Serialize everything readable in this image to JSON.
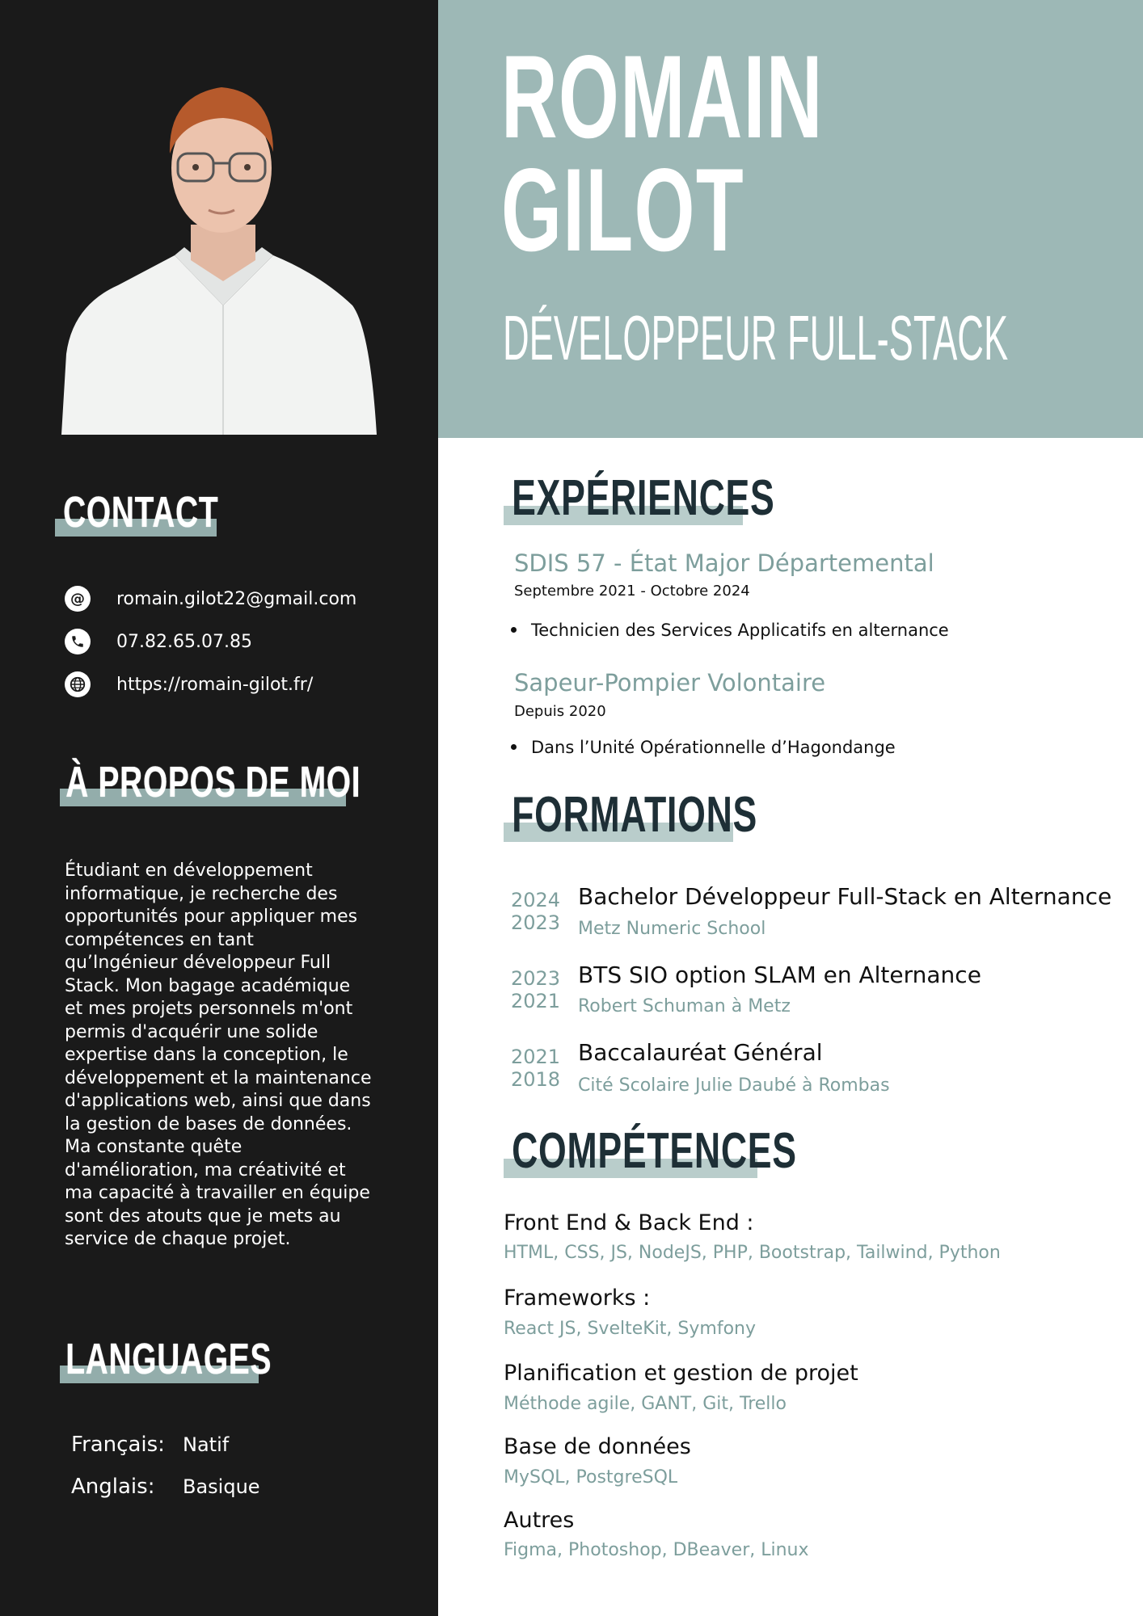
{
  "name": {
    "line1": "ROMAIN",
    "line2": "GILOT"
  },
  "job_title": "DÉVELOPPEUR FULL-STACK",
  "colors": {
    "sidebar": "#1a1a1a",
    "header": "#9db8b6",
    "accent": "#7d9e9c",
    "heading": "#1e2f36"
  },
  "sidebar": {
    "contact": {
      "heading": "CONTACT",
      "items": [
        {
          "icon": "at-icon",
          "value": "romain.gilot22@gmail.com"
        },
        {
          "icon": "phone-icon",
          "value": "07.82.65.07.85"
        },
        {
          "icon": "globe-icon",
          "value": "https://romain-gilot.fr/"
        }
      ]
    },
    "about": {
      "heading": "À PROPOS DE MOI",
      "text": "Étudiant en développement informatique, je recherche des opportunités pour appliquer mes compétences en tant qu’Ingénieur développeur Full Stack. Mon bagage académique et mes projets personnels m'ont permis d'acquérir une solide expertise dans la conception, le développement et la maintenance d'applications web, ainsi que dans la gestion de bases de données. Ma constante quête d'amélioration, ma créativité et ma capacité à travailler en équipe sont des atouts que je mets au service de chaque projet."
    },
    "languages": {
      "heading": "LANGUAGES",
      "items": [
        {
          "label": "Français:",
          "level": "Natif"
        },
        {
          "label": "Anglais:",
          "level": "Basique"
        }
      ]
    }
  },
  "experiences": {
    "heading": "EXPÉRIENCES",
    "items": [
      {
        "title": "SDIS 57 - État Major Départemental",
        "date": "Septembre 2021 - Octobre 2024",
        "bullet": "Technicien des Services Applicatifs en alternance"
      },
      {
        "title": "Sapeur-Pompier Volontaire",
        "date": "Depuis 2020",
        "bullet": "Dans l’Unité Opérationnelle d’Hagondange"
      }
    ]
  },
  "formations": {
    "heading": "FORMATIONS",
    "items": [
      {
        "end": "2024",
        "start": "2023",
        "title": "Bachelor Développeur Full-Stack en Alternance",
        "school": "Metz Numeric School"
      },
      {
        "end": "2023",
        "start": "2021",
        "title": "BTS SIO option SLAM en Alternance",
        "school": "Robert Schuman à Metz"
      },
      {
        "end": "2021",
        "start": "2018",
        "title": "Baccalauréat Général",
        "school": "Cité Scolaire Julie Daubé à Rombas"
      }
    ]
  },
  "competences": {
    "heading": "COMPÉTENCES",
    "items": [
      {
        "category": "Front End & Back End :",
        "list": "HTML, CSS,  JS, NodeJS, PHP, Bootstrap, Tailwind, Python"
      },
      {
        "category": "Frameworks :",
        "list": "React JS, SvelteKit, Symfony"
      },
      {
        "category": "Planification et gestion de projet",
        "list": "Méthode agile, GANT, Git, Trello"
      },
      {
        "category": "Base de données",
        "list": "MySQL, PostgreSQL"
      },
      {
        "category": "Autres",
        "list": "Figma, Photoshop, DBeaver, Linux"
      }
    ]
  }
}
